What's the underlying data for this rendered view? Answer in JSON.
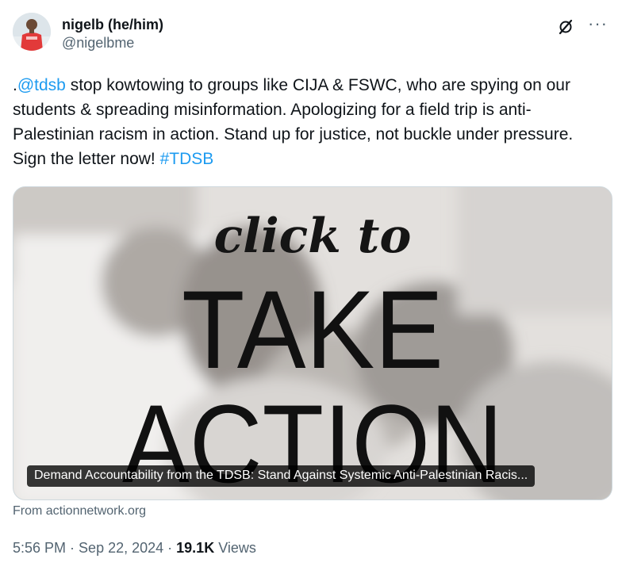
{
  "author": {
    "display_name": "nigelb (he/him)",
    "handle": "@nigelbme"
  },
  "header_icons": [
    "grok-icon",
    "more-icon"
  ],
  "more_glyph": "···",
  "tweet": {
    "prefix": ".",
    "mention": "@tdsb",
    "text": " stop kowtowing to groups like CIJA & FSWC, who are spying on our students & spreading misinformation. Apologizing for a field trip is anti-Palestinian racism in action. Stand up for justice, not buckle under pressure. Sign the letter now!  ",
    "hashtag": "#TDSB"
  },
  "card": {
    "image_text_line1": "click to",
    "image_text_line2": "TAKE",
    "image_text_line3": "ACTION",
    "caption": "Demand Accountability from the TDSB: Stand Against Systemic Anti-Palestinian Racis...",
    "source": "From actionnetwork.org"
  },
  "meta": {
    "time": "5:56 PM",
    "sep1": " · ",
    "date": "Sep 22, 2024",
    "sep2": " · ",
    "views_count": "19.1K",
    "views_label": " Views"
  },
  "colors": {
    "link": "#1d9bf0",
    "secondary_text": "#536471",
    "primary_text": "#0f1419",
    "avatar_shirt": "#e23a3a"
  }
}
